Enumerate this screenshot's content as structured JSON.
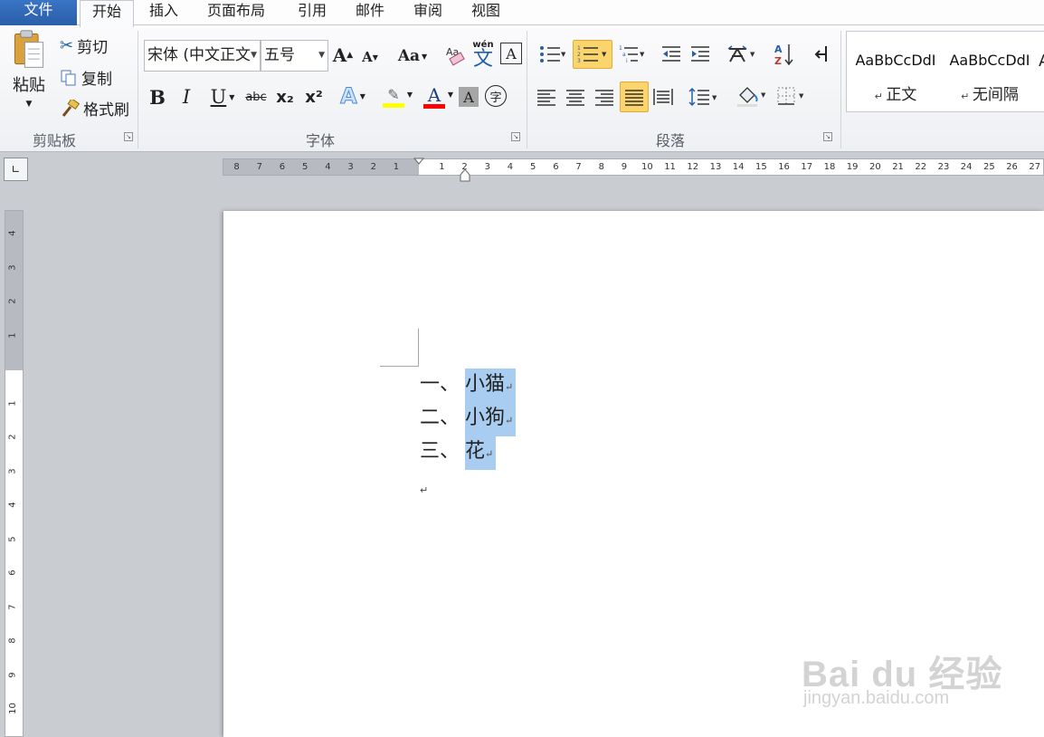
{
  "tabs": {
    "file": "文件",
    "home": "开始",
    "insert": "插入",
    "layout": "页面布局",
    "references": "引用",
    "mailings": "邮件",
    "review": "审阅",
    "view": "视图"
  },
  "clipboard": {
    "paste": "粘贴",
    "cut": "剪切",
    "copy": "复制",
    "format_painter": "格式刷",
    "group_label": "剪贴板"
  },
  "font": {
    "font_name": "宋体 (中文正文",
    "font_size": "五号",
    "grow": "A",
    "shrink": "A",
    "change_case": "Aa",
    "phonetic": "wén",
    "bold": "B",
    "italic": "I",
    "underline": "U",
    "strikethrough": "abc",
    "subscript": "x₂",
    "superscript": "x²",
    "text_effects": "A",
    "font_color": "A",
    "char_shading": "A",
    "enclose": "字",
    "group_label": "字体",
    "highlight_color": "#ffff00",
    "font_color_value": "#ff0000"
  },
  "paragraph": {
    "group_label": "段落"
  },
  "styles": {
    "normal_sample": "AaBbCcDdI",
    "normal_name": "正文",
    "nospacing_sample": "AaBbCcDdI",
    "nospacing_name": "无间隔"
  },
  "ruler": {
    "h_left": [
      "8",
      "7",
      "6",
      "5",
      "4",
      "3",
      "2",
      "1"
    ],
    "h_right": [
      "1",
      "2",
      "3",
      "4",
      "5",
      "6",
      "7",
      "8",
      "9",
      "10",
      "11",
      "12",
      "13",
      "14",
      "15",
      "16",
      "17",
      "18",
      "19",
      "20",
      "21",
      "22",
      "23",
      "24",
      "25",
      "26",
      "27"
    ],
    "v_top": [
      "4",
      "3",
      "2",
      "1"
    ],
    "v_bottom": [
      "1",
      "2",
      "3",
      "4",
      "5",
      "6",
      "7",
      "8",
      "9",
      "10"
    ]
  },
  "document": {
    "items": [
      {
        "num": "一、",
        "text": "小猫"
      },
      {
        "num": "二、",
        "text": "小狗"
      },
      {
        "num": "三、",
        "text": "花"
      }
    ],
    "para_mark": "↵",
    "selection_color": "#a8cdf0"
  },
  "watermark": {
    "logo": "Bai du 经验",
    "url": "jingyan.baidu.com"
  }
}
